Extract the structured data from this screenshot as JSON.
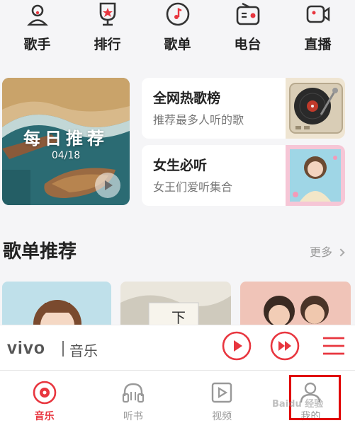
{
  "topnav": {
    "items": [
      {
        "label": "歌手",
        "icon": "singer-icon"
      },
      {
        "label": "排行",
        "icon": "ranking-icon"
      },
      {
        "label": "歌单",
        "icon": "playlist-icon"
      },
      {
        "label": "电台",
        "icon": "radio-icon"
      },
      {
        "label": "直播",
        "icon": "live-icon"
      }
    ]
  },
  "daily": {
    "title": "每日推荐",
    "date": "04/18"
  },
  "cards": [
    {
      "title": "全网热歌榜",
      "subtitle": "推荐最多人听的歌"
    },
    {
      "title": "女生必听",
      "subtitle": "女王们爱听集合"
    }
  ],
  "playlists": {
    "title": "歌单推荐",
    "more": "更多"
  },
  "player": {
    "brand": "vivo",
    "label": "音乐"
  },
  "tabbar": {
    "items": [
      {
        "label": "音乐",
        "active": true
      },
      {
        "label": "听书",
        "active": false
      },
      {
        "label": "视频",
        "active": false
      },
      {
        "label": "我的",
        "active": false
      }
    ]
  },
  "watermark": "Baidu 经验",
  "colors": {
    "accent": "#e8363f",
    "highlight": "#e00000"
  }
}
